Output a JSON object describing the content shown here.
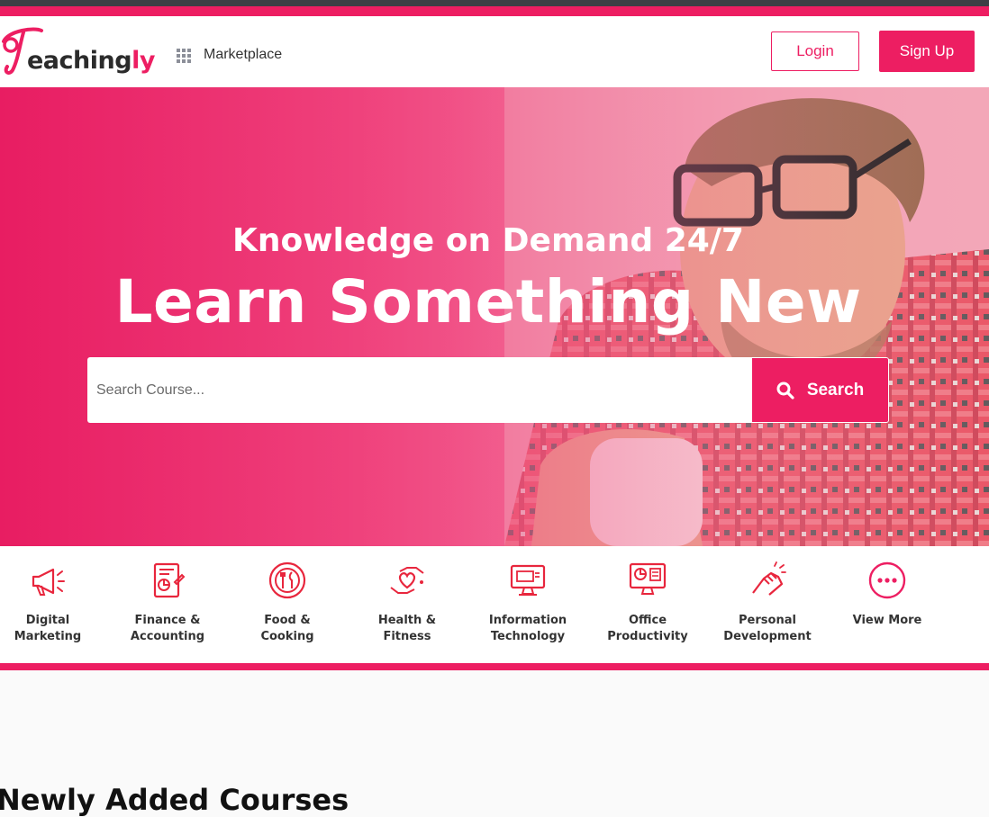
{
  "brand": {
    "logo_prefix": "eaching",
    "logo_suffix": "ly",
    "accent_color": "#ed1e62"
  },
  "nav": {
    "marketplace_label": "Marketplace",
    "login_label": "Login",
    "signup_label": "Sign Up"
  },
  "hero": {
    "subtitle": "Knowledge on Demand 24/7",
    "title": "Learn Something New",
    "search_placeholder": "Search Course...",
    "search_button_label": "Search"
  },
  "categories": [
    {
      "label": "Digital\nMarketing",
      "icon": "megaphone-icon"
    },
    {
      "label": "Finance &\nAccounting",
      "icon": "finance-report-icon"
    },
    {
      "label": "Food &\nCooking",
      "icon": "plate-cutlery-icon"
    },
    {
      "label": "Health &\nFitness",
      "icon": "heart-hands-icon"
    },
    {
      "label": "Information\nTechnology",
      "icon": "computer-monitor-icon"
    },
    {
      "label": "Office\nProductivity",
      "icon": "office-monitor-chart-icon"
    },
    {
      "label": "Personal\nDevelopment",
      "icon": "handshake-icon"
    },
    {
      "label": "View More",
      "icon": "more-dots-icon"
    }
  ],
  "sections": {
    "newly_added_title": "Newly Added Courses"
  }
}
